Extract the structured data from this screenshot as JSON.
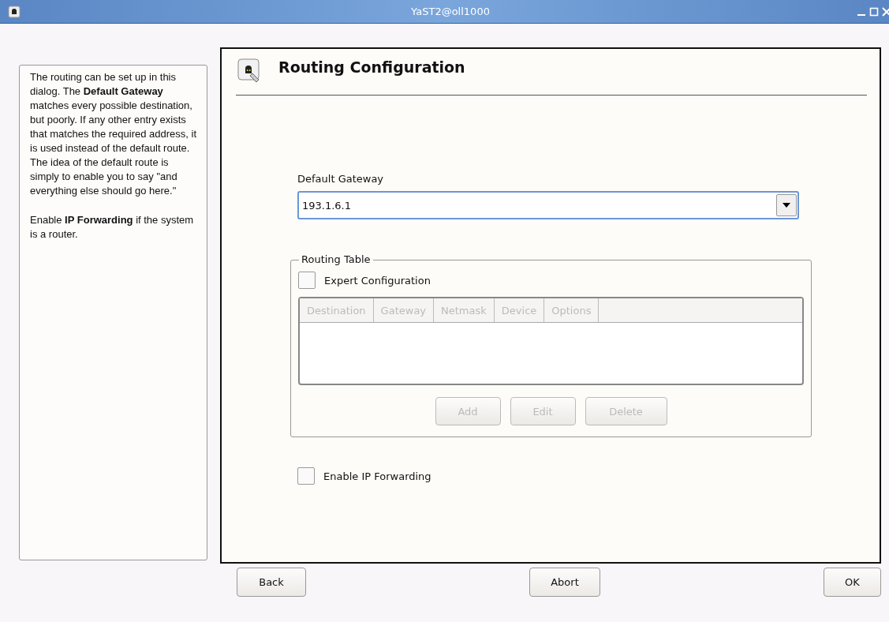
{
  "window": {
    "title": "YaST2@oll1000"
  },
  "help": {
    "paragraphs": [
      "The routing can be set up in this dialog. The **Default Gateway** matches every possible destination, but poorly. If any other entry exists that matches the required address, it is used instead of the default route. The idea of the default route is simply to enable you to say \"and everything else should go here.\"",
      "Enable **IP Forwarding** if the system is a router."
    ]
  },
  "dialog": {
    "title": "Routing Configuration",
    "gateway": {
      "label": "Default Gateway",
      "value": "193.1.6.1"
    },
    "routing_table": {
      "title": "Routing Table",
      "expert": {
        "label": "Expert Configuration",
        "checked": false
      },
      "columns": [
        {
          "label": "Destination",
          "disabled": true
        },
        {
          "label": "Gateway",
          "disabled": true
        },
        {
          "label": "Netmask",
          "disabled": true
        },
        {
          "label": "Device",
          "disabled": true
        },
        {
          "label": "Options",
          "disabled": true
        }
      ],
      "buttons": [
        {
          "label": "Add",
          "disabled": true
        },
        {
          "label": "Edit",
          "disabled": true
        },
        {
          "label": "Delete",
          "disabled": true
        }
      ]
    },
    "ip_forwarding": {
      "label": "Enable IP Forwarding",
      "checked": false
    }
  },
  "buttons": [
    {
      "label": "Back"
    },
    {
      "label": "Abort"
    },
    {
      "label": "OK"
    }
  ]
}
